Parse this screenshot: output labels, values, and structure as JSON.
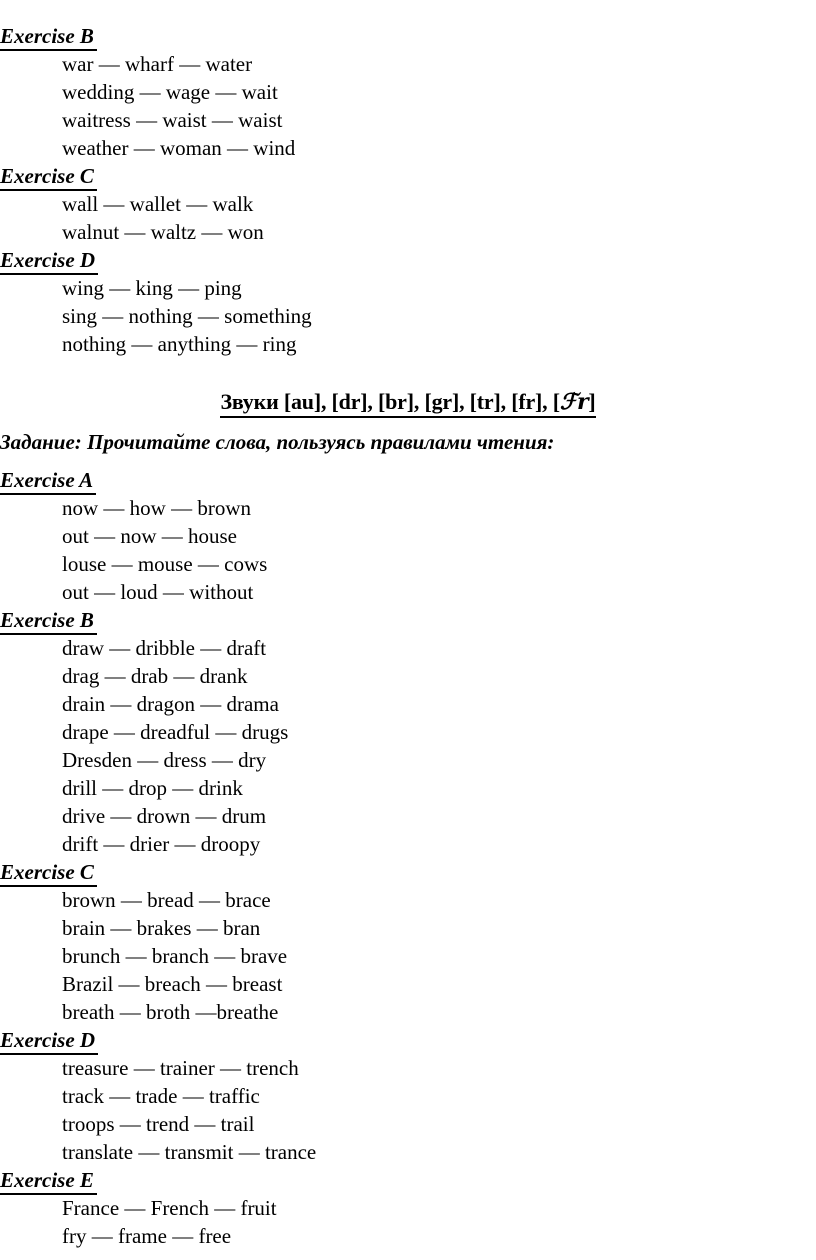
{
  "document": {
    "sections": [
      {
        "header": "Exercise B",
        "lines": [
          "war — wharf — water",
          "wedding — wage — wait",
          "waitress — waist — waist",
          "weather — woman — wind"
        ]
      },
      {
        "header": "Exercise C",
        "lines": [
          "wall — wallet — walk",
          "walnut — waltz — won"
        ]
      },
      {
        "header": "Exercise D",
        "lines": [
          "wing — king — ping",
          "sing — nothing — something",
          "nothing — anything — ring"
        ]
      }
    ],
    "sounds_title": {
      "prefix": "Звуки ",
      "sounds_text": "[au], [dr], [br], [gr], [tr], [fr], [",
      "script_symbol": "ℱr",
      "suffix": "]"
    },
    "task_line": "Задание: Прочитайте слова, пользуясь правилами чтения:",
    "sections2": [
      {
        "header": "Exercise A",
        "lines": [
          "now — how — brown",
          "out — now — house",
          "louse — mouse — cows",
          "out — loud — without"
        ]
      },
      {
        "header": "Exercise B",
        "lines": [
          "draw — dribble — draft",
          "drag — drab — drank",
          "drain — dragon — drama",
          "drape — dreadful — drugs",
          "Dresden — dress — dry",
          "drill — drop — drink",
          "drive — drown — drum",
          "drift — drier — droopy"
        ]
      },
      {
        "header": "Exercise C",
        "lines": [
          "brown — bread — brace",
          "brain — brakes — bran",
          "brunch — branch — brave",
          "Brazil — breach — breast",
          "breath — broth —breathe"
        ]
      },
      {
        "header": "Exercise D",
        "lines": [
          "treasure — trainer — trench",
          "track — trade — traffic",
          "troops — trend — trail",
          "translate — transmit — trance"
        ]
      },
      {
        "header": "Exercise E",
        "lines": [
          "France — French — fruit",
          "fry — frame — free"
        ]
      }
    ]
  }
}
